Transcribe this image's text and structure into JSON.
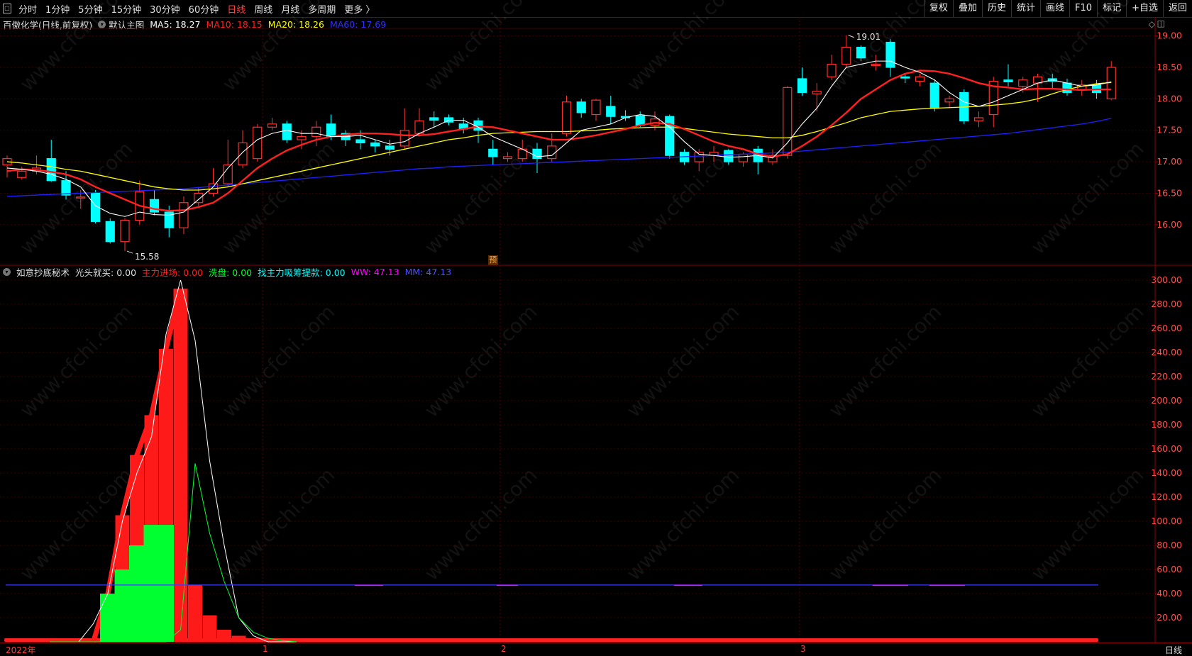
{
  "toolbar": {
    "periods": [
      "分时",
      "1分钟",
      "5分钟",
      "15分钟",
      "30分钟",
      "60分钟",
      "日线",
      "周线",
      "月线",
      "多周期",
      "更多 〉"
    ],
    "active_period": "日线",
    "right_buttons": [
      "复权",
      "叠加",
      "历史",
      "统计",
      "画线",
      "F10",
      "标记",
      "+自选",
      "返回"
    ]
  },
  "main_legend": {
    "stock": "百傲化学(日线,前复权)",
    "template": "默认主图",
    "ma5": "MA5: 18.27",
    "ma10": "MA10: 18.15",
    "ma20": "MA20: 18.26",
    "ma60": "MA60: 17.69"
  },
  "sub_legend": {
    "name": "如意抄底秘术",
    "i1": "光头就买: 0.00",
    "i2": "主力进场: 0.00",
    "i3": "洗盘: 0.00",
    "i4": "找主力吸筹提款: 0.00",
    "i5": "WW: 47.13",
    "i6": "MM: 47.13"
  },
  "colors": {
    "up": "#ff3030",
    "down": "#00ffff",
    "ma5": "#ffffff",
    "ma10": "#ff2020",
    "ma20": "#ffff00",
    "ma60": "#2020ff",
    "green": "#00ff30",
    "magenta": "#ff00ff",
    "blue": "#3a3aff"
  },
  "price_axis": [
    "19.00",
    "18.50",
    "18.00",
    "17.50",
    "17.00",
    "16.50",
    "16.00"
  ],
  "sub_axis": [
    "300.00",
    "280.00",
    "260.00",
    "240.00",
    "220.00",
    "200.00",
    "180.00",
    "160.00",
    "140.00",
    "120.00",
    "100.00",
    "80.00",
    "60.00",
    "40.00",
    "20.00"
  ],
  "annotations": {
    "high": "19.01",
    "low": "15.58",
    "pre": "预"
  },
  "x_labels": [
    "2022年",
    "1",
    "2",
    "3"
  ],
  "bottom_right": "日线",
  "watermark": "www.cfchi.com",
  "chart_data": {
    "type": "candlestick",
    "candles": [
      {
        "o": 16.95,
        "c": 17.05,
        "h": 17.1,
        "l": 16.75
      },
      {
        "o": 16.75,
        "c": 16.85,
        "h": 16.92,
        "l": 16.72
      },
      {
        "o": 16.85,
        "c": 16.9,
        "h": 17.1,
        "l": 16.8
      },
      {
        "o": 17.05,
        "c": 16.7,
        "h": 17.35,
        "l": 16.68
      },
      {
        "o": 16.7,
        "c": 16.47,
        "h": 16.85,
        "l": 16.4
      },
      {
        "o": 16.43,
        "c": 16.44,
        "h": 16.55,
        "l": 16.25
      },
      {
        "o": 16.5,
        "c": 16.05,
        "h": 16.55,
        "l": 16.02
      },
      {
        "o": 16.05,
        "c": 15.73,
        "h": 16.1,
        "l": 15.7
      },
      {
        "o": 15.73,
        "c": 16.07,
        "h": 16.1,
        "l": 15.58
      },
      {
        "o": 16.07,
        "c": 16.52,
        "h": 16.7,
        "l": 16.0
      },
      {
        "o": 16.4,
        "c": 16.2,
        "h": 16.55,
        "l": 16.15
      },
      {
        "o": 16.2,
        "c": 15.95,
        "h": 16.3,
        "l": 15.8
      },
      {
        "o": 15.95,
        "c": 16.35,
        "h": 16.45,
        "l": 15.85
      },
      {
        "o": 16.35,
        "c": 16.5,
        "h": 16.6,
        "l": 16.3
      },
      {
        "o": 16.5,
        "c": 16.65,
        "h": 16.9,
        "l": 16.45
      },
      {
        "o": 16.65,
        "c": 16.95,
        "h": 17.35,
        "l": 16.6
      },
      {
        "o": 16.95,
        "c": 17.3,
        "h": 17.5,
        "l": 16.9
      },
      {
        "o": 17.05,
        "c": 17.55,
        "h": 17.6,
        "l": 17.0
      },
      {
        "o": 17.55,
        "c": 17.6,
        "h": 17.7,
        "l": 17.5
      },
      {
        "o": 17.6,
        "c": 17.35,
        "h": 17.65,
        "l": 17.3
      },
      {
        "o": 17.35,
        "c": 17.4,
        "h": 17.5,
        "l": 17.2
      },
      {
        "o": 17.4,
        "c": 17.55,
        "h": 17.65,
        "l": 17.25
      },
      {
        "o": 17.6,
        "c": 17.4,
        "h": 17.75,
        "l": 17.35
      },
      {
        "o": 17.45,
        "c": 17.35,
        "h": 17.5,
        "l": 17.25
      },
      {
        "o": 17.35,
        "c": 17.3,
        "h": 17.5,
        "l": 17.2
      },
      {
        "o": 17.3,
        "c": 17.25,
        "h": 17.35,
        "l": 17.15
      },
      {
        "o": 17.25,
        "c": 17.2,
        "h": 17.35,
        "l": 17.1
      },
      {
        "o": 17.25,
        "c": 17.5,
        "h": 17.85,
        "l": 17.2
      },
      {
        "o": 17.45,
        "c": 17.65,
        "h": 17.85,
        "l": 17.4
      },
      {
        "o": 17.7,
        "c": 17.66,
        "h": 17.8,
        "l": 17.55
      },
      {
        "o": 17.7,
        "c": 17.63,
        "h": 17.75,
        "l": 17.58
      },
      {
        "o": 17.6,
        "c": 17.52,
        "h": 17.7,
        "l": 17.45
      },
      {
        "o": 17.65,
        "c": 17.5,
        "h": 17.7,
        "l": 17.3
      },
      {
        "o": 17.2,
        "c": 17.08,
        "h": 17.35,
        "l": 16.95
      },
      {
        "o": 17.05,
        "c": 17.08,
        "h": 17.15,
        "l": 17.0
      },
      {
        "o": 17.05,
        "c": 17.2,
        "h": 17.35,
        "l": 17.0
      },
      {
        "o": 17.2,
        "c": 17.05,
        "h": 17.3,
        "l": 16.82
      },
      {
        "o": 17.05,
        "c": 17.25,
        "h": 17.45,
        "l": 17.0
      },
      {
        "o": 17.45,
        "c": 17.95,
        "h": 18.05,
        "l": 17.4
      },
      {
        "o": 17.95,
        "c": 17.78,
        "h": 18.0,
        "l": 17.7
      },
      {
        "o": 17.75,
        "c": 17.98,
        "h": 18.0,
        "l": 17.65
      },
      {
        "o": 17.88,
        "c": 17.72,
        "h": 18.05,
        "l": 17.6
      },
      {
        "o": 17.72,
        "c": 17.7,
        "h": 17.82,
        "l": 17.65
      },
      {
        "o": 17.73,
        "c": 17.58,
        "h": 17.8,
        "l": 17.55
      },
      {
        "o": 17.58,
        "c": 17.68,
        "h": 17.8,
        "l": 17.5
      },
      {
        "o": 17.72,
        "c": 17.1,
        "h": 17.75,
        "l": 17.05
      },
      {
        "o": 17.15,
        "c": 17.0,
        "h": 17.2,
        "l": 16.95
      },
      {
        "o": 17.0,
        "c": 17.15,
        "h": 17.2,
        "l": 16.85
      },
      {
        "o": 17.1,
        "c": 17.15,
        "h": 17.25,
        "l": 17.0
      },
      {
        "o": 17.18,
        "c": 17.0,
        "h": 17.2,
        "l": 16.95
      },
      {
        "o": 17.0,
        "c": 17.12,
        "h": 17.15,
        "l": 16.92
      },
      {
        "o": 17.2,
        "c": 17.0,
        "h": 17.25,
        "l": 16.8
      },
      {
        "o": 17.0,
        "c": 17.1,
        "h": 17.2,
        "l": 16.95
      },
      {
        "o": 17.1,
        "c": 18.18,
        "h": 18.2,
        "l": 17.05
      },
      {
        "o": 18.32,
        "c": 18.1,
        "h": 18.5,
        "l": 18.05
      },
      {
        "o": 18.08,
        "c": 18.12,
        "h": 18.25,
        "l": 17.8
      },
      {
        "o": 18.35,
        "c": 18.55,
        "h": 18.7,
        "l": 18.3
      },
      {
        "o": 18.55,
        "c": 18.82,
        "h": 19.01,
        "l": 18.5
      },
      {
        "o": 18.82,
        "c": 18.65,
        "h": 18.85,
        "l": 18.6
      },
      {
        "o": 18.53,
        "c": 18.55,
        "h": 18.7,
        "l": 18.45
      },
      {
        "o": 18.9,
        "c": 18.5,
        "h": 18.95,
        "l": 18.35
      },
      {
        "o": 18.35,
        "c": 18.33,
        "h": 18.4,
        "l": 18.25
      },
      {
        "o": 18.28,
        "c": 18.35,
        "h": 18.4,
        "l": 18.2
      },
      {
        "o": 18.25,
        "c": 17.85,
        "h": 18.3,
        "l": 17.8
      },
      {
        "o": 17.95,
        "c": 18.0,
        "h": 18.05,
        "l": 17.85
      },
      {
        "o": 18.1,
        "c": 17.65,
        "h": 18.15,
        "l": 17.6
      },
      {
        "o": 17.65,
        "c": 17.7,
        "h": 17.8,
        "l": 17.55
      },
      {
        "o": 17.75,
        "c": 18.28,
        "h": 18.35,
        "l": 17.55
      },
      {
        "o": 18.3,
        "c": 18.27,
        "h": 18.55,
        "l": 18.2
      },
      {
        "o": 18.2,
        "c": 18.3,
        "h": 18.35,
        "l": 18.1
      },
      {
        "o": 18.25,
        "c": 18.35,
        "h": 18.4,
        "l": 17.95
      },
      {
        "o": 18.32,
        "c": 18.28,
        "h": 18.4,
        "l": 18.15
      },
      {
        "o": 18.25,
        "c": 18.1,
        "h": 18.32,
        "l": 18.05
      },
      {
        "o": 18.15,
        "c": 18.22,
        "h": 18.3,
        "l": 18.05
      },
      {
        "o": 18.22,
        "c": 18.1,
        "h": 18.3,
        "l": 18.0
      },
      {
        "o": 18.0,
        "c": 18.5,
        "h": 18.6,
        "l": 17.98
      }
    ],
    "ma5": [
      16.9,
      16.88,
      16.85,
      16.8,
      16.72,
      16.6,
      16.3,
      16.18,
      16.13,
      16.2,
      16.16,
      16.15,
      16.2,
      16.4,
      16.6,
      16.9,
      17.15,
      17.35,
      17.45,
      17.5,
      17.45,
      17.45,
      17.4,
      17.4,
      17.42,
      17.35,
      17.28,
      17.32,
      17.45,
      17.55,
      17.66,
      17.66,
      17.55,
      17.4,
      17.3,
      17.2,
      17.08,
      17.1,
      17.3,
      17.5,
      17.55,
      17.6,
      17.7,
      17.75,
      17.72,
      17.55,
      17.32,
      17.12,
      17.1,
      17.07,
      17.08,
      17.1,
      17.06,
      17.3,
      17.6,
      17.85,
      18.2,
      18.5,
      18.55,
      18.6,
      18.6,
      18.5,
      18.42,
      18.3,
      18.1,
      17.95,
      17.88,
      17.95,
      18.05,
      18.15,
      18.25,
      18.3,
      18.25,
      18.2,
      18.22,
      18.27
    ],
    "ma10": [
      16.85,
      16.88,
      16.87,
      16.84,
      16.8,
      16.72,
      16.6,
      16.5,
      16.4,
      16.3,
      16.25,
      16.22,
      16.23,
      16.28,
      16.35,
      16.5,
      16.7,
      16.9,
      17.05,
      17.18,
      17.27,
      17.35,
      17.4,
      17.43,
      17.45,
      17.45,
      17.44,
      17.42,
      17.42,
      17.44,
      17.48,
      17.52,
      17.56,
      17.55,
      17.5,
      17.45,
      17.4,
      17.35,
      17.35,
      17.38,
      17.42,
      17.47,
      17.52,
      17.58,
      17.62,
      17.6,
      17.52,
      17.42,
      17.32,
      17.25,
      17.2,
      17.12,
      17.08,
      17.12,
      17.25,
      17.4,
      17.58,
      17.78,
      18.0,
      18.15,
      18.3,
      18.4,
      18.45,
      18.44,
      18.4,
      18.33,
      18.25,
      18.2,
      18.18,
      18.15,
      18.16,
      18.16,
      18.15,
      18.14,
      18.15,
      18.15
    ],
    "ma20": [
      17.0,
      16.98,
      16.95,
      16.92,
      16.88,
      16.85,
      16.8,
      16.75,
      16.7,
      16.65,
      16.6,
      16.57,
      16.55,
      16.55,
      16.57,
      16.6,
      16.65,
      16.7,
      16.75,
      16.8,
      16.85,
      16.9,
      16.95,
      17.0,
      17.05,
      17.1,
      17.15,
      17.2,
      17.25,
      17.3,
      17.35,
      17.38,
      17.42,
      17.45,
      17.46,
      17.47,
      17.48,
      17.48,
      17.48,
      17.49,
      17.5,
      17.52,
      17.53,
      17.54,
      17.55,
      17.55,
      17.53,
      17.5,
      17.47,
      17.44,
      17.42,
      17.4,
      17.38,
      17.38,
      17.42,
      17.48,
      17.55,
      17.62,
      17.7,
      17.75,
      17.8,
      17.82,
      17.84,
      17.85,
      17.86,
      17.87,
      17.88,
      17.9,
      17.92,
      17.95,
      18.0,
      18.08,
      18.15,
      18.2,
      18.24,
      18.26
    ],
    "ma60": [
      16.45,
      16.46,
      16.47,
      16.48,
      16.49,
      16.5,
      16.51,
      16.52,
      16.53,
      16.54,
      16.55,
      16.56,
      16.57,
      16.59,
      16.61,
      16.63,
      16.65,
      16.67,
      16.69,
      16.71,
      16.73,
      16.75,
      16.77,
      16.79,
      16.81,
      16.83,
      16.85,
      16.87,
      16.89,
      16.9,
      16.92,
      16.93,
      16.94,
      16.95,
      16.96,
      16.97,
      16.98,
      16.99,
      17.0,
      17.01,
      17.02,
      17.03,
      17.04,
      17.05,
      17.06,
      17.07,
      17.08,
      17.09,
      17.1,
      17.11,
      17.12,
      17.13,
      17.14,
      17.15,
      17.17,
      17.19,
      17.21,
      17.23,
      17.25,
      17.27,
      17.29,
      17.31,
      17.33,
      17.35,
      17.37,
      17.39,
      17.41,
      17.43,
      17.45,
      17.48,
      17.51,
      17.54,
      17.57,
      17.6,
      17.64,
      17.69
    ],
    "sub_red": [
      0,
      0,
      0,
      0,
      40,
      105,
      155,
      188,
      243,
      293,
      47,
      22,
      10,
      5,
      3,
      2,
      1,
      0
    ],
    "sub_green": [
      0,
      0,
      0,
      0,
      40,
      60,
      80,
      97,
      97,
      0,
      0,
      0,
      0,
      0,
      0,
      0,
      0,
      0
    ],
    "sub_white": [
      0,
      0,
      0,
      15,
      40,
      100,
      140,
      170,
      255,
      300,
      250,
      150,
      80,
      20,
      5,
      0,
      0,
      0
    ],
    "sub_green_line": [
      0,
      0,
      0,
      0,
      0,
      0,
      0,
      0,
      0,
      10,
      148,
      90,
      50,
      20,
      8,
      3,
      1,
      0
    ],
    "ww": 47.13,
    "mm": 47.13
  }
}
